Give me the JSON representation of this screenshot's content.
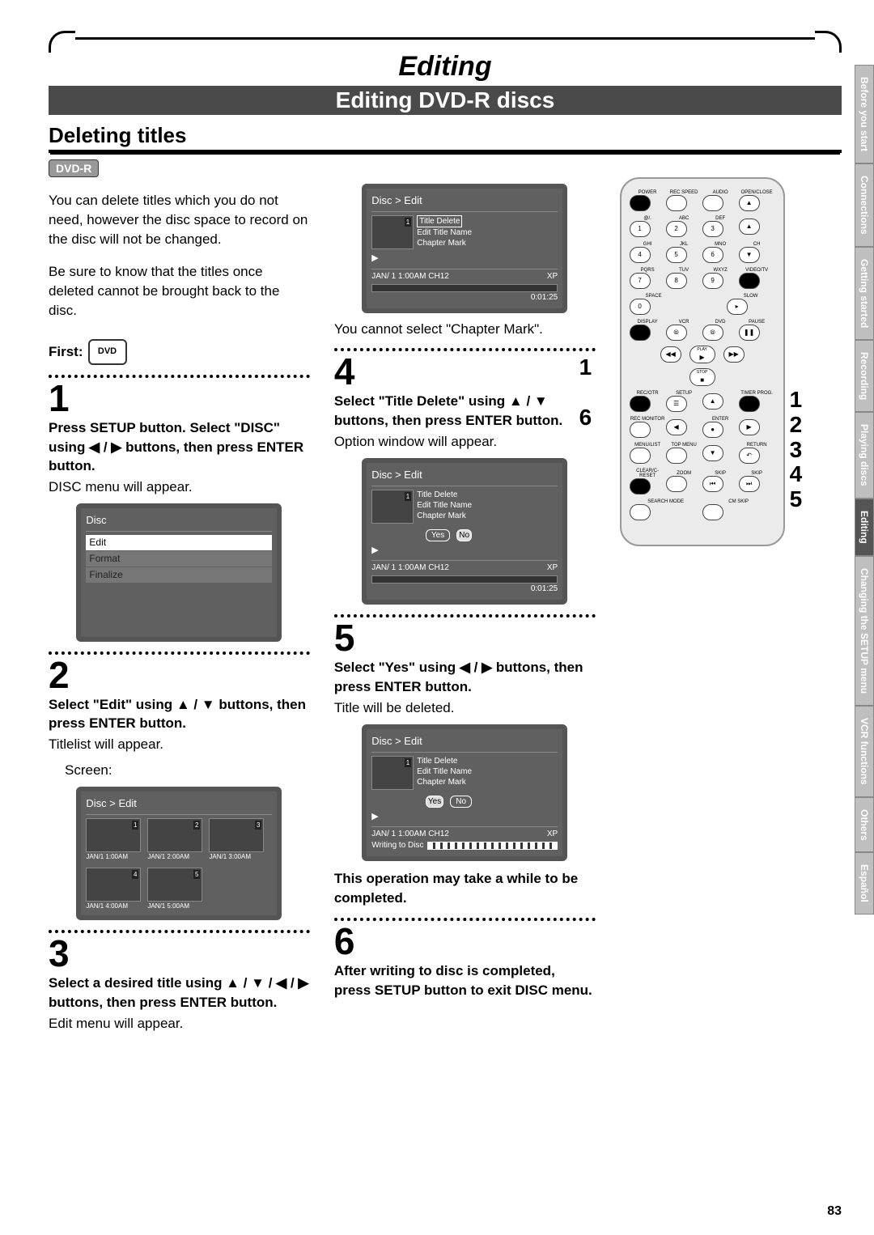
{
  "main_title": "Editing",
  "sub_title": "Editing DVD-R discs",
  "section": "Deleting titles",
  "badge": "DVD-R",
  "intro1": "You can delete titles which you do not need, however the disc space to record on the disc will not be changed.",
  "intro2": "Be sure to know that the titles once deleted cannot be brought back to the disc.",
  "first": "First:",
  "disc_icon_label": "DVD",
  "step1": {
    "num": "1",
    "head": "Press SETUP button. Select \"DISC\" using ◀ / ▶ buttons, then press ENTER button.",
    "sub": "DISC menu will appear."
  },
  "disc_menu": {
    "title": "Disc",
    "items": [
      "Edit",
      "Format",
      "Finalize"
    ]
  },
  "step2": {
    "num": "2",
    "head": "Select \"Edit\" using ▲ / ▼ buttons, then press ENTER button.",
    "sub": "Titlelist will appear.",
    "screen": "Screen:"
  },
  "titlelist": {
    "header": "Disc > Edit",
    "cells": [
      {
        "n": "1",
        "cap": "JAN/1  1:00AM"
      },
      {
        "n": "2",
        "cap": "JAN/1  2:00AM"
      },
      {
        "n": "3",
        "cap": "JAN/1  3:00AM"
      },
      {
        "n": "4",
        "cap": "JAN/1  4:00AM"
      },
      {
        "n": "5",
        "cap": "JAN/1  5:00AM"
      }
    ]
  },
  "step3": {
    "num": "3",
    "head": "Select a desired title using ▲ / ▼ / ◀ / ▶ buttons, then press ENTER button.",
    "sub": "Edit menu will appear."
  },
  "osd_common": {
    "header": "Disc > Edit",
    "thumb": "1",
    "side": [
      "Title Delete",
      "Edit Title Name",
      "Chapter Mark"
    ],
    "footer_left": "JAN/ 1   1:00AM  CH12",
    "footer_right": "XP",
    "timecode": "0:01:25",
    "yes": "Yes",
    "no": "No",
    "writing": "Writing to Disc"
  },
  "step3_note": "You cannot select \"Chapter Mark\".",
  "step4": {
    "num": "4",
    "head": "Select \"Title Delete\" using ▲ / ▼ buttons, then press ENTER button.",
    "sub": "Option window will appear."
  },
  "step5": {
    "num": "5",
    "head": "Select \"Yes\" using ◀ / ▶ buttons, then press ENTER button.",
    "sub": "Title will be deleted."
  },
  "step5_note": "This operation may take a while to be completed.",
  "step6": {
    "num": "6",
    "head": "After writing to disc is completed, press SETUP button to exit DISC menu."
  },
  "remote_callouts_left": [
    "1",
    "6"
  ],
  "remote_callouts_right": [
    "1",
    "2",
    "3",
    "4",
    "5"
  ],
  "remote_labels": {
    "row1": [
      "POWER",
      "REC SPEED",
      "AUDIO",
      "OPEN/CLOSE"
    ],
    "row2": [
      "@/.",
      "ABC",
      "DEF",
      ""
    ],
    "row2n": [
      "1",
      "2",
      "3",
      "▲"
    ],
    "row3": [
      "GHI",
      "JKL",
      "MNO",
      "CH"
    ],
    "row3n": [
      "4",
      "5",
      "6",
      "▼"
    ],
    "row4": [
      "PQRS",
      "TUV",
      "WXYZ",
      "VIDEO/TV"
    ],
    "row4n": [
      "7",
      "8",
      "9",
      "●"
    ],
    "row5": [
      "",
      "SPACE",
      "",
      "SLOW"
    ],
    "row5n": [
      "",
      "0",
      "",
      "▸"
    ],
    "row6": [
      "DISPLAY",
      "VCR",
      "DVD",
      "PAUSE"
    ],
    "row7": [
      "◀◀",
      "PLAY",
      "▶▶"
    ],
    "row8": [
      "",
      "STOP",
      ""
    ],
    "row9": [
      "REC/OTR",
      "SETUP",
      "",
      "TIMER PROG."
    ],
    "row10": [
      "REC MONITOR",
      "",
      "ENTER",
      ""
    ],
    "row11": [
      "MENU/LIST",
      "TOP MENU",
      "",
      "RETURN"
    ],
    "row12": [
      "CLEAR/C-RESET",
      "ZOOM",
      "SKIP",
      "SKIP"
    ],
    "row13": [
      "SEARCH MODE",
      "CM SKIP",
      "",
      ""
    ]
  },
  "tabs": [
    "Before you start",
    "Connections",
    "Getting started",
    "Recording",
    "Playing discs",
    "Editing",
    "Changing the SETUP menu",
    "VCR functions",
    "Others",
    "Español"
  ],
  "page_num": "83"
}
